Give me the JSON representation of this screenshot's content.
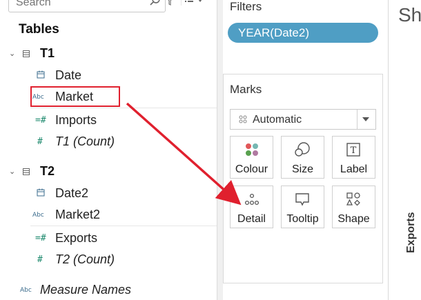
{
  "data_pane": {
    "search_placeholder": "Search",
    "tables_heading": "Tables",
    "tables": [
      {
        "name": "T1",
        "fields": [
          {
            "label": "Date",
            "icon": "calendar-icon",
            "italic": false
          },
          {
            "label": "Market",
            "icon": "Abc",
            "italic": false
          },
          {
            "label": "Imports",
            "icon": "measure-icon",
            "italic": false
          },
          {
            "label": "T1 (Count)",
            "icon": "#",
            "italic": true
          }
        ]
      },
      {
        "name": "T2",
        "fields": [
          {
            "label": "Date2",
            "icon": "calendar-icon",
            "italic": false
          },
          {
            "label": "Market2",
            "icon": "Abc",
            "italic": false
          },
          {
            "label": "Exports",
            "icon": "measure-icon",
            "italic": false
          },
          {
            "label": "T2 (Count)",
            "icon": "#",
            "italic": true
          }
        ]
      }
    ],
    "measure_names": {
      "label": "Measure Names",
      "icon": "Abc"
    }
  },
  "filters": {
    "label": "Filters",
    "pill": "YEAR(Date2)"
  },
  "marks": {
    "label": "Marks",
    "mark_type": "Automatic",
    "buttons": [
      {
        "label": "Colour",
        "icon": "colour-icon"
      },
      {
        "label": "Size",
        "icon": "size-icon"
      },
      {
        "label": "Label",
        "icon": "label-icon"
      },
      {
        "label": "Detail",
        "icon": "detail-icon"
      },
      {
        "label": "Tooltip",
        "icon": "tooltip-icon"
      },
      {
        "label": "Shape",
        "icon": "shape-icon"
      }
    ]
  },
  "sheet": {
    "title_fragment": "Sh",
    "axis_label": "Exports"
  },
  "annotation": {
    "highlight_color": "#e0202e",
    "pill_color": "#4f9ec4"
  }
}
